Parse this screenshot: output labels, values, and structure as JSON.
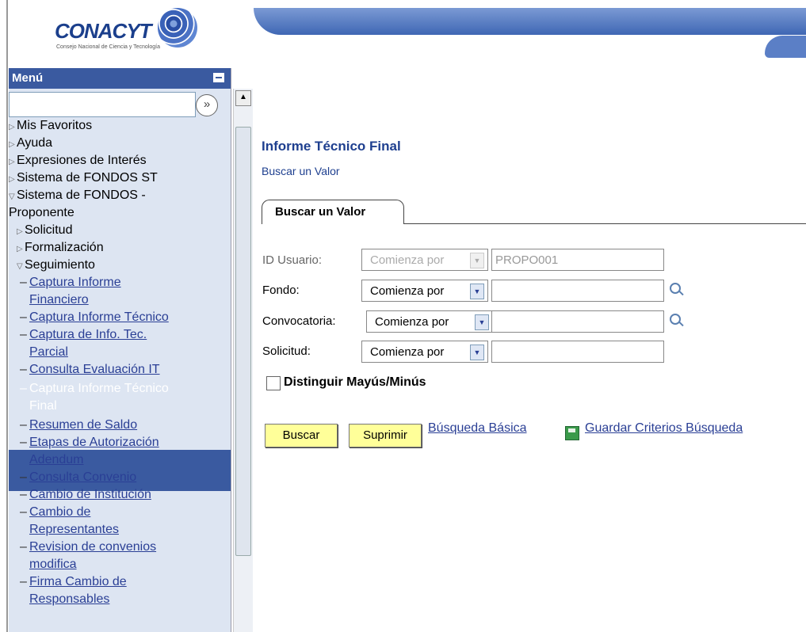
{
  "logo": {
    "name": "CONACYT",
    "tagline": "Consejo Nacional de Ciencia y Tecnología"
  },
  "menu": {
    "title": "Menú",
    "search_value": "",
    "items": [
      {
        "label": "Mis Favoritos"
      },
      {
        "label": "Ayuda"
      },
      {
        "label": "Expresiones de Interés"
      },
      {
        "label": "Sistema de FONDOS ST"
      },
      {
        "label": "Sistema de FONDOS -"
      },
      {
        "label": "Proponente"
      },
      {
        "label": "Solicitud"
      },
      {
        "label": "Formalización"
      },
      {
        "label": "Seguimiento"
      },
      {
        "label": "Captura Informe"
      },
      {
        "label": "Financiero"
      },
      {
        "label": "Captura Informe Técnico"
      },
      {
        "label": "Captura de Info. Tec."
      },
      {
        "label": "Parcial"
      },
      {
        "label": "Consulta Evaluación IT"
      },
      {
        "label": "Captura Informe Técnico"
      },
      {
        "label": "Final"
      },
      {
        "label": "Resumen de Saldo"
      },
      {
        "label": "Etapas de Autorización"
      },
      {
        "label": "Adendum"
      },
      {
        "label": "Consulta Convenio"
      },
      {
        "label": "Cambio de Institución"
      },
      {
        "label": "Cambio de"
      },
      {
        "label": "Representantes"
      },
      {
        "label": "Revision de convenios"
      },
      {
        "label": "modifica"
      },
      {
        "label": "Firma Cambio de"
      },
      {
        "label": "Responsables"
      }
    ]
  },
  "page": {
    "title": "Informe Técnico Final",
    "subtitle": "Buscar un Valor",
    "tab_label": "Buscar un Valor"
  },
  "form": {
    "user_label": "ID Usuario:",
    "user_operator": "Comienza por",
    "user_value": "PROPO001",
    "fondo_label": "Fondo:",
    "fondo_operator": "Comienza por",
    "fondo_value": "",
    "convocatoria_label": "Convocatoria:",
    "convocatoria_operator": "Comienza por",
    "convocatoria_value": "",
    "solicitud_label": "Solicitud:",
    "solicitud_operator": "Comienza por",
    "solicitud_value": "",
    "case_label": "Distinguir Mayús/Minús",
    "case_checked": false
  },
  "actions": {
    "search_button": "Buscar",
    "clear_button": "Suprimir",
    "basic_search_link": "Búsqueda Básica",
    "save_criteria_link": "Guardar Criterios Búsqueda"
  }
}
